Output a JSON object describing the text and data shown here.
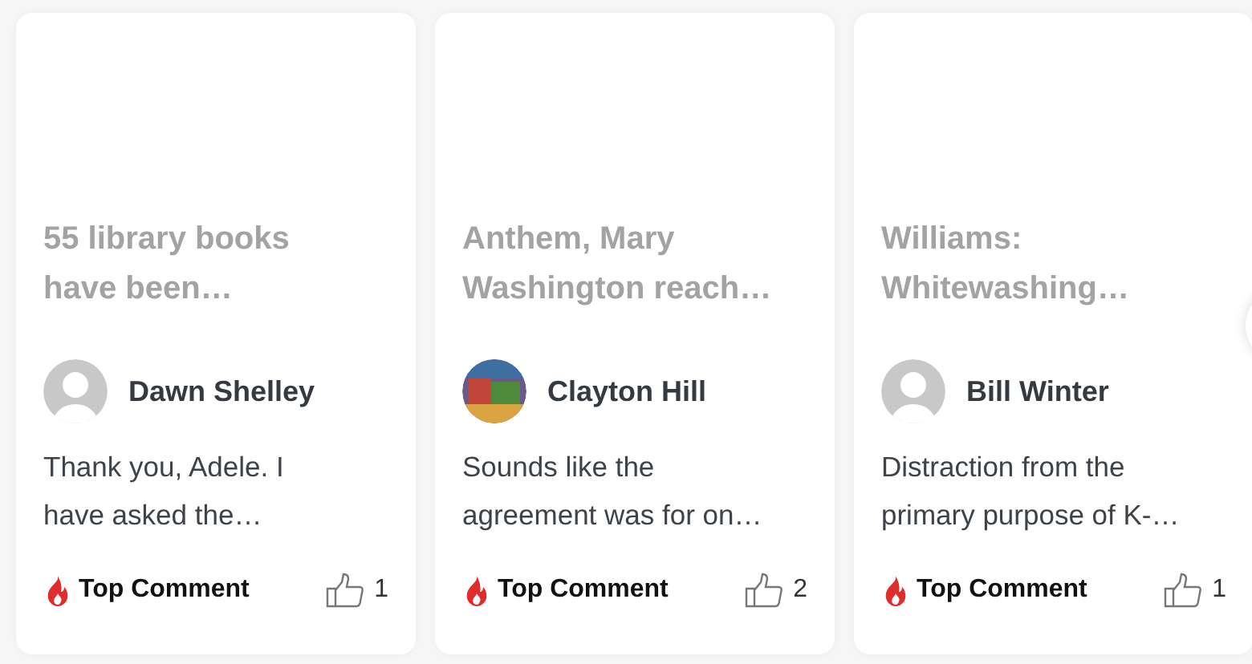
{
  "cards": [
    {
      "headline": "55 library books\nhave been…",
      "author": "Dawn Shelley",
      "kind": "default",
      "comment": "Thank you, Adele. I\nhave asked the…",
      "badge": "Top Comment",
      "likes": "1"
    },
    {
      "headline": "Anthem, Mary\nWashington reach…",
      "author": "Clayton Hill",
      "kind": "photo",
      "comment": "Sounds like the\nagreement was for on…",
      "badge": "Top Comment",
      "likes": "2"
    },
    {
      "headline": "Williams:\nWhitewashing…",
      "author": "Bill Winter",
      "kind": "default",
      "comment": "Distraction from the\nprimary purpose of K-…",
      "badge": "Top Comment",
      "likes": "1"
    }
  ]
}
